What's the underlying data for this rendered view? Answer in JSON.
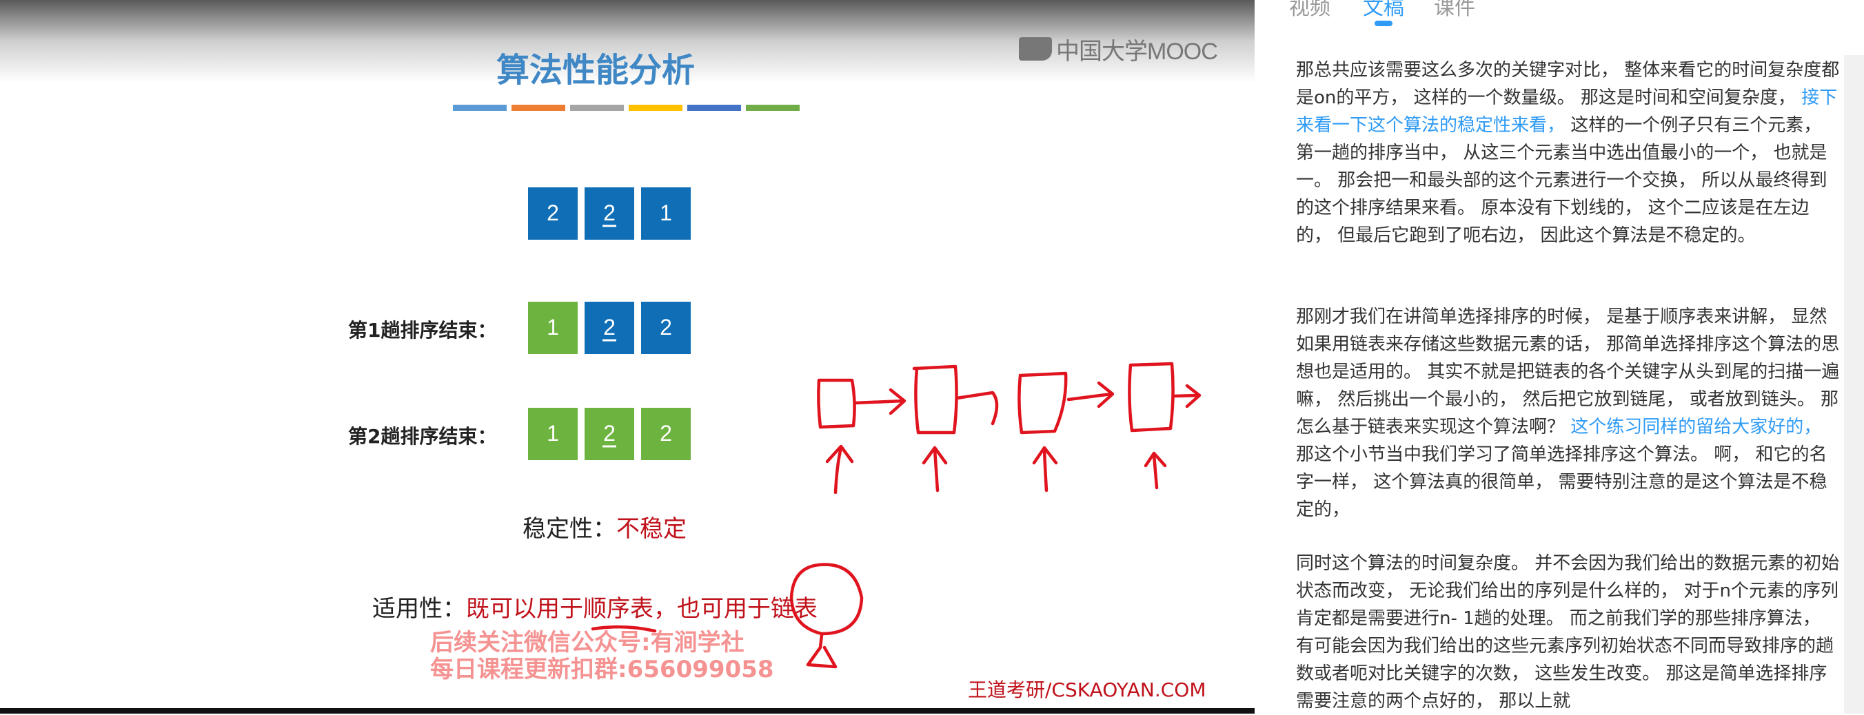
{
  "slide": {
    "title": "算法性能分析",
    "logo_text": "中国大学MOOC",
    "accent_colors": [
      "#5b9bd5",
      "#ed7d31",
      "#a5a5a5",
      "#ffc000",
      "#4472c4",
      "#70ad47"
    ],
    "rows": [
      {
        "label": "",
        "cells": [
          {
            "value": "2",
            "underline": false,
            "color": "#0f6eb6"
          },
          {
            "value": "2",
            "underline": true,
            "color": "#0f6eb6"
          },
          {
            "value": "1",
            "underline": false,
            "color": "#0f6eb6"
          }
        ]
      },
      {
        "label": "第1趟排序结束：",
        "cells": [
          {
            "value": "1",
            "underline": false,
            "color": "#6db33f"
          },
          {
            "value": "2",
            "underline": true,
            "color": "#0f6eb6"
          },
          {
            "value": "2",
            "underline": false,
            "color": "#0f6eb6"
          }
        ]
      },
      {
        "label": "第2趟排序结束：",
        "cells": [
          {
            "value": "1",
            "underline": false,
            "color": "#6db33f"
          },
          {
            "value": "2",
            "underline": true,
            "color": "#6db33f"
          },
          {
            "value": "2",
            "underline": false,
            "color": "#6db33f"
          }
        ]
      }
    ],
    "stability_label": "稳定性：",
    "stability_value": "不稳定",
    "applicability_label": "适用性：",
    "applicability_value": "既可以用于顺序表，也可用于链表",
    "watermark_line1": "后续关注微信公众号:有涧学社",
    "watermark_line2": "每日课程更新扣群:656099058",
    "brand": "王道考研/CSKAOYAN.COM"
  },
  "sidebar": {
    "tabs": [
      {
        "label": "视频",
        "active": false
      },
      {
        "label": "文稿",
        "active": true
      },
      {
        "label": "课件",
        "active": false
      }
    ],
    "paragraphs": [
      [
        {
          "text": "那总共应该需要这么多次的关键字对比， 整体来看它的时间复杂度都是on的平方， 这样的一个数量级。 那这是时间和空间复杂度， ",
          "highlight": false
        },
        {
          "text": "接下来看一下这个算法的稳定性来看，",
          "highlight": true
        },
        {
          "text": " 这样的一个例子只有三个元素， 第一趟的排序当中， 从这三个元素当中选出值最小的一个， 也就是一。 那会把一和最头部的这个元素进行一个交换， 所以从最终得到的这个排序结果来看。 原本没有下划线的， 这个二应该是在左边的， 但最后它跑到了呃右边， 因此这个算法是不稳定的。",
          "highlight": false
        }
      ],
      [
        {
          "text": "那刚才我们在讲简单选择排序的时候， 是基于顺序表来讲解， 显然如果用链表来存储这些数据元素的话， 那简单选择排序这个算法的思想也是适用的。 其实不就是把链表的各个关键字从头到尾的扫描一遍嘛， 然后挑出一个最小的， 然后把它放到链尾， 或者放到链头。 那怎么基于链表来实现这个算法啊？ ",
          "highlight": false
        },
        {
          "text": "这个练习同样的留给大家好的，",
          "highlight": true
        },
        {
          "text": " 那这个小节当中我们学习了简单选择排序这个算法。 啊， 和它的名字一样， 这个算法真的很简单， 需要特别注意的是这个算法是不稳定的，",
          "highlight": false
        }
      ],
      [
        {
          "text": "同时这个算法的时间复杂度。 并不会因为我们给出的数据元素的初始状态而改变， 无论我们给出的序列是什么样的， 对于n个元素的序列肯定都是需要进行n- 1趟的处理。 而之前我们学的那些排序算法， 有可能会因为我们给出的这些元素序列初始状态不同而导致排序的趟数或者呃对比关键字的次数， 这些发生改变。 那这是简单选择排序需要注意的两个点好的， 那以上就",
          "highlight": false
        }
      ]
    ]
  }
}
